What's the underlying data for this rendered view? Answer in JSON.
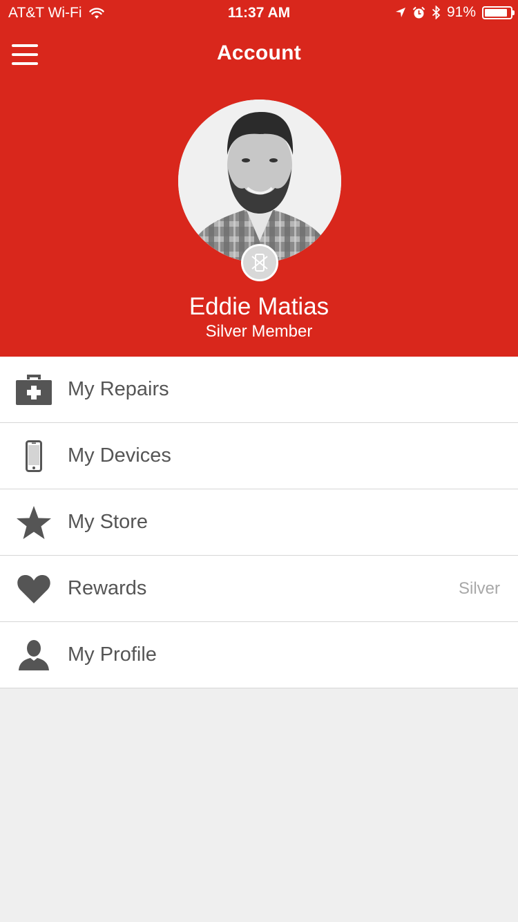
{
  "status_bar": {
    "carrier": "AT&T Wi-Fi",
    "time": "11:37 AM",
    "battery_percent": "91%",
    "battery_level": 0.91
  },
  "nav": {
    "title": "Account",
    "menu_icon": "hamburger-menu-icon"
  },
  "profile": {
    "name": "Eddie Matias",
    "tier": "Silver Member",
    "badge_icon": "tier-badge-icon"
  },
  "menu": {
    "items": [
      {
        "label": "My Repairs",
        "icon": "medkit-icon",
        "value": ""
      },
      {
        "label": "My Devices",
        "icon": "phone-icon",
        "value": ""
      },
      {
        "label": "My Store",
        "icon": "star-icon",
        "value": ""
      },
      {
        "label": "Rewards",
        "icon": "heart-icon",
        "value": "Silver"
      },
      {
        "label": "My Profile",
        "icon": "person-icon",
        "value": ""
      }
    ]
  },
  "colors": {
    "brand_red": "#d9271c",
    "icon_gray": "#555555",
    "background": "#efefef"
  }
}
